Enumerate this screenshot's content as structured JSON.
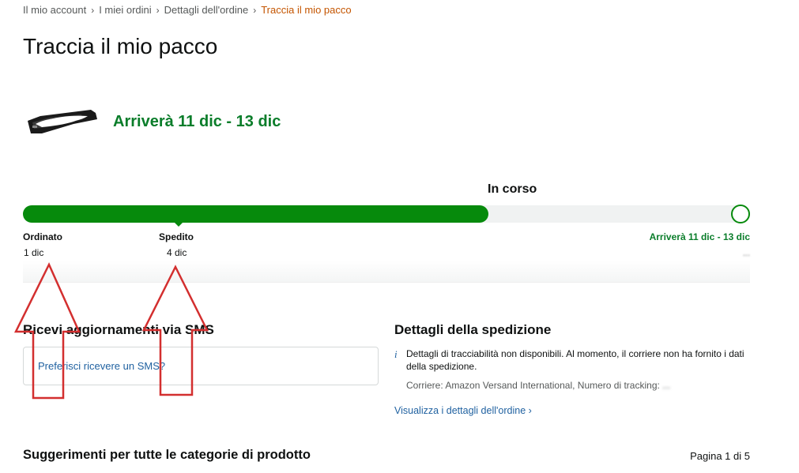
{
  "breadcrumb": {
    "items": [
      "Il mio account",
      "I miei ordini",
      "Dettagli dell'ordine"
    ],
    "current": "Traccia il mio pacco",
    "separator": "›"
  },
  "page": {
    "title": "Traccia il mio pacco"
  },
  "delivery": {
    "arrival_headline": "Arriverà 11 dic - 13 dic",
    "status": "In corso",
    "progress_fraction": 0.64,
    "steps": [
      {
        "name": "Ordinato",
        "date": "1 dic"
      },
      {
        "name": "Spedito",
        "date": "4 dic"
      },
      {
        "name": "Arriverà 11 dic - 13 dic",
        "date": "..."
      }
    ]
  },
  "sms": {
    "heading": "Ricevi aggiornamenti via SMS",
    "link": "Preferisci ricevere un SMS?"
  },
  "shipment": {
    "heading": "Dettagli della spedizione",
    "info_icon": "i",
    "info_text": "Dettagli di tracciabilità non disponibili. Al momento, il corriere non ha fornito i dati della spedizione.",
    "carrier_label": "Corriere: Amazon Versand International, Numero di tracking: ",
    "tracking_masked": "...",
    "order_details_link": "Visualizza i dettagli dell'ordine ›"
  },
  "suggestions": {
    "heading": "Suggerimenti per tutte le categorie di prodotto",
    "page_counter": "Pagina 1 di 5"
  },
  "colors": {
    "progress_green": "#068a0c",
    "arrival_green": "#0a7d2a",
    "link_blue": "#2162a1",
    "breadcrumb_current": "#c45500",
    "annotation_red": "#d32f2f"
  }
}
